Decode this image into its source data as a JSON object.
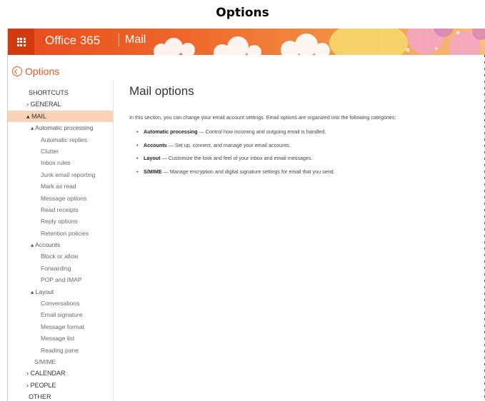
{
  "caption": "Options",
  "topbar": {
    "brand": "Office 365",
    "app": "Mail",
    "colors": {
      "primary": "#e84a1c",
      "waffle_bg": "#d23a10"
    },
    "waffle_icon": "app-launcher-icon"
  },
  "back": {
    "label": "Options",
    "icon": "back-arrow-icon"
  },
  "nav": [
    {
      "label": "SHORTCUTS",
      "level": "plain"
    },
    {
      "label": "› GENERAL",
      "level": "0"
    },
    {
      "label": "▴ MAIL",
      "level": "0",
      "selected": true
    },
    {
      "label": "▴ Automatic processing",
      "level": "1"
    },
    {
      "label": "Automatic replies",
      "level": "2"
    },
    {
      "label": "Clutter",
      "level": "2"
    },
    {
      "label": "Inbox rules",
      "level": "2"
    },
    {
      "label": "Junk email reporting",
      "level": "2"
    },
    {
      "label": "Mark as read",
      "level": "2"
    },
    {
      "label": "Message options",
      "level": "2"
    },
    {
      "label": "Read receipts",
      "level": "2"
    },
    {
      "label": "Reply options",
      "level": "2"
    },
    {
      "label": "Retention policies",
      "level": "2"
    },
    {
      "label": "▴ Accounts",
      "level": "1"
    },
    {
      "label": "Block or allow",
      "level": "2"
    },
    {
      "label": "Forwarding",
      "level": "2"
    },
    {
      "label": "POP and IMAP",
      "level": "2"
    },
    {
      "label": "▴ Layout",
      "level": "1"
    },
    {
      "label": "Conversations",
      "level": "2"
    },
    {
      "label": "Email signature",
      "level": "2"
    },
    {
      "label": "Message format",
      "level": "2"
    },
    {
      "label": "Message list",
      "level": "2"
    },
    {
      "label": "Reading pane",
      "level": "2"
    },
    {
      "label": "S/MIME",
      "level": "1plain"
    },
    {
      "label": "› CALENDAR",
      "level": "0"
    },
    {
      "label": "› PEOPLE",
      "level": "0"
    },
    {
      "label": "OTHER",
      "level": "plain"
    }
  ],
  "main": {
    "title": "Mail options",
    "intro": "In this section, you can change your email account settings. Email options are organized into the following categories:",
    "categories": [
      {
        "name": "Automatic processing",
        "desc": " — Control how incoming and outgoing email is handled."
      },
      {
        "name": "Accounts",
        "desc": " — Set up, connect, and manage your email accounts."
      },
      {
        "name": "Layout",
        "desc": " — Customize the look and feel of your inbox and email messages."
      },
      {
        "name": "S/MIME",
        "desc": " — Manage encryption and digital signature settings for email that you send."
      }
    ]
  }
}
